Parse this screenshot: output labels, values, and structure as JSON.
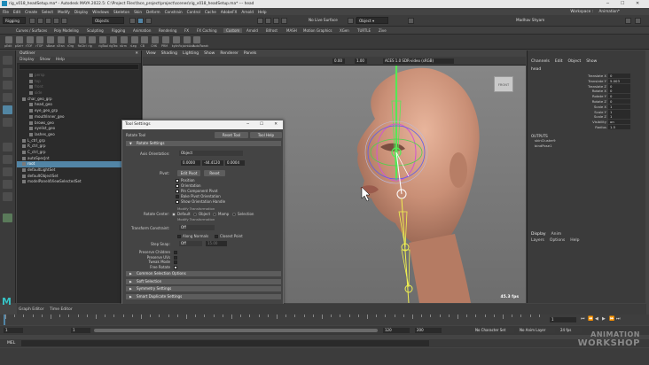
{
  "window": {
    "title": "rig_v018_headSetup.ma* - Autodesk MAYA 2022.5: C:\\Project Files\\face_project\\project\\scenes\\rig_v018_headSetup.ma* --- head"
  },
  "menubar": [
    "File",
    "Edit",
    "Create",
    "Select",
    "Modify",
    "Display",
    "Windows",
    "Skeleton",
    "Skin",
    "Deform",
    "Constrain",
    "Control",
    "Cache",
    "AdobeFX",
    "Arnold",
    "Help"
  ],
  "workspace": {
    "label": "Workspace :",
    "value": "Animation*"
  },
  "statusline": {
    "mode": "Rigging",
    "objects_dropdown": "Objects",
    "live_surface": "No Live Surface",
    "object_field": "Object ▾",
    "user": "Madhav Shyam"
  },
  "shelf": {
    "tabs": [
      "Curves / Surfaces",
      "Poly Modeling",
      "Sculpting",
      "Rigging",
      "Animation",
      "Rendering",
      "FX",
      "FX Caching",
      "Custom",
      "Arnold",
      "Bifrost",
      "MASH",
      "Motion Graphics",
      "XGen",
      "TURTLE",
      "Zive"
    ],
    "active_tab": "Custom",
    "items": [
      "pEdit",
      "pSel+",
      "rTOF",
      "rTOP",
      "sBase",
      "sTran",
      "rOrg",
      "fixCtrl",
      "rig",
      "rigTool",
      "rigTex",
      "rArm",
      "rLeg",
      "CB",
      "CHK",
      "PRM",
      "kylInFo",
      "jointAxis",
      "AutoTweak"
    ]
  },
  "outliner": {
    "title": "Outliner",
    "menu": [
      "Display",
      "Show",
      "Help"
    ],
    "items": [
      {
        "label": "persp",
        "indent": 1,
        "dim": true
      },
      {
        "label": "top",
        "indent": 1,
        "dim": true
      },
      {
        "label": "front",
        "indent": 1,
        "dim": true
      },
      {
        "label": "side",
        "indent": 1,
        "dim": true
      },
      {
        "label": "char_geo_grp",
        "indent": 0,
        "dim": false
      },
      {
        "label": "head_geo",
        "indent": 1,
        "dim": false
      },
      {
        "label": "eye_geo_grp",
        "indent": 1,
        "dim": false
      },
      {
        "label": "mouthInner_geo",
        "indent": 1,
        "dim": false
      },
      {
        "label": "brows_geo",
        "indent": 1,
        "dim": false
      },
      {
        "label": "eyelist_geo",
        "indent": 1,
        "dim": false
      },
      {
        "label": "lashes_geo",
        "indent": 1,
        "dim": false
      },
      {
        "label": "L_ctrl_grp",
        "indent": 0,
        "dim": false
      },
      {
        "label": "R_ctrl_grp",
        "indent": 0,
        "dim": false
      },
      {
        "label": "C_ctrl_grp",
        "indent": 0,
        "dim": false
      },
      {
        "label": "autoSpecJnt",
        "indent": 0,
        "dim": false
      },
      {
        "label": "root",
        "indent": 0,
        "dim": false,
        "selected": true
      },
      {
        "label": "defaultLightSet",
        "indent": 0,
        "dim": false
      },
      {
        "label": "defaultObjectSet",
        "indent": 0,
        "dim": false
      },
      {
        "label": "modelPanel4ViewSelectedSet",
        "indent": 0,
        "dim": false
      }
    ]
  },
  "viewport": {
    "menu": [
      "View",
      "Shading",
      "Lighting",
      "Show",
      "Renderer",
      "Panels"
    ],
    "toolbar_fields": {
      "near": "0.00",
      "far": "1.00",
      "colorspace": "ACES 1.0 SDR-video (sRGB)"
    },
    "fps": "45.3 fps",
    "viewcube_label": "FRONT"
  },
  "channelbox": {
    "menu": [
      "Channels",
      "Edit",
      "Object",
      "Show"
    ],
    "node": "head",
    "attributes": [
      {
        "name": "Translate X",
        "value": "0"
      },
      {
        "name": "Translate Y",
        "value": "5.003"
      },
      {
        "name": "Translate Z",
        "value": "0"
      },
      {
        "name": "Rotate X",
        "value": "0"
      },
      {
        "name": "Rotate Y",
        "value": "0"
      },
      {
        "name": "Rotate Z",
        "value": "0"
      },
      {
        "name": "Scale X",
        "value": "1"
      },
      {
        "name": "Scale Y",
        "value": "1"
      },
      {
        "name": "Scale Z",
        "value": "1"
      },
      {
        "name": "Visibility",
        "value": "on"
      },
      {
        "name": "Radius",
        "value": "1.5"
      }
    ],
    "outputs_label": "OUTPUTS",
    "outputs": [
      "skinCluster9",
      "bindPose1"
    ],
    "layer_tabs": [
      "Display",
      "Anim"
    ],
    "layer_menu": [
      "Layers",
      "Options",
      "Help"
    ]
  },
  "tool_settings": {
    "window_title": "Tool Settings",
    "tool_name": "Rotate Tool",
    "reset_button": "Reset Tool",
    "help_button": "Tool Help",
    "section": "Rotate Settings",
    "axis_orientation_label": "Axis Orientation:",
    "axis_orientation_value": "Object",
    "xyz": [
      "0.0000",
      "-44.4120",
      "0.0004"
    ],
    "pivot_label": "Pivot:",
    "edit_pivot": "Edit Pivot",
    "reset": "Reset",
    "checks": [
      {
        "label": "Position",
        "checked": true
      },
      {
        "label": "Orientation",
        "checked": true
      },
      {
        "label": "Pin Component Pivot",
        "checked": true
      },
      {
        "label": "Bake Pivot Orientation",
        "checked": false
      },
      {
        "label": "Show Orientation Handle",
        "checked": true
      }
    ],
    "modify_transformation": "Modify Transformation",
    "rotate_center_label": "Rotate Center:",
    "rotate_center_options": [
      {
        "label": "Default",
        "on": true
      },
      {
        "label": "Object",
        "on": false
      },
      {
        "label": "Mamp",
        "on": false
      },
      {
        "label": "Selection",
        "on": false
      }
    ],
    "modify_transformation_sub": "Modify Transformation",
    "transform_constraint_label": "Transform Constraint:",
    "transform_constraint_value": "Off",
    "along_normals": "Along Normals",
    "closest_point": "Closest Point",
    "step_snap_label": "Step Snap:",
    "step_snap_value": "Off",
    "step_snap_amount": "15.00",
    "options": [
      {
        "label": "Preserve Children",
        "checked": false
      },
      {
        "label": "Preserve UVs",
        "checked": false
      },
      {
        "label": "Tweak Mode",
        "checked": false
      },
      {
        "label": "Free Rotate",
        "checked": true
      }
    ],
    "collapsed": [
      "Common Selection Options",
      "Soft Selection",
      "Symmetry Settings",
      "Smart Duplicate Settings"
    ]
  },
  "timeline": {
    "tabs": [
      "Graph Editor",
      "Time Editor"
    ],
    "start": "1",
    "current": "1",
    "range_start": "1",
    "range_end": "120",
    "anim_end": "200",
    "character_set": "No Character Set",
    "anim_layer": "No Anim Layer",
    "fps": "24 fps"
  },
  "cmdline": {
    "lang": "MEL"
  },
  "watermark": {
    "line1": "ANIMATION",
    "line2": "WORKSHOP"
  }
}
